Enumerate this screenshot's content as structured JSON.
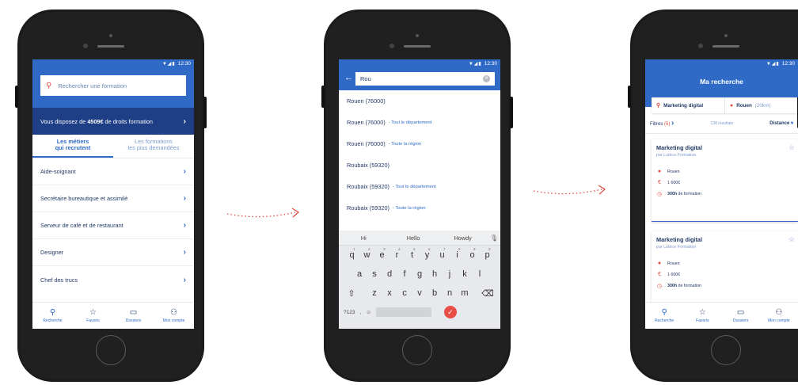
{
  "colors": {
    "primary": "#2f6bc6",
    "navy": "#1e3f86",
    "accent": "#e04b3f"
  },
  "status_time": "12:30",
  "screen1": {
    "search_placeholder": "Rechercher une formation",
    "banner_prefix": "Vous disposez de ",
    "banner_amount": "4509€",
    "banner_suffix": " de droits formation",
    "tabs": [
      {
        "line1": "Les métiers",
        "line2": "qui recrutent"
      },
      {
        "line1": "Les formations",
        "line2": "les plus demandées"
      }
    ],
    "items": [
      "Aide-soignant",
      "Secrétaire bureautique et assimilé",
      "Serveur de café et de restaurant",
      "Designer",
      "Chef des trucs"
    ]
  },
  "tabbar": [
    "Recherche",
    "Favoris",
    "Dossiers",
    "Mon compte"
  ],
  "screen2": {
    "query": "Rou",
    "suggestions": [
      {
        "main": "Rouen (76000)",
        "sub": ""
      },
      {
        "main": "Rouen (76000)",
        "sub": "- Tout le département"
      },
      {
        "main": "Rouen (76000)",
        "sub": "- Toute la région"
      },
      {
        "main": "Roubaix (59320)",
        "sub": ""
      },
      {
        "main": "Roubaix (59320)",
        "sub": "- Tout le département"
      },
      {
        "main": "Roubaix (59320)",
        "sub": "- Toute la région"
      }
    ],
    "predictions": [
      "Hi",
      "Hello",
      "Howdy"
    ],
    "keys_row1": [
      "q",
      "w",
      "e",
      "r",
      "t",
      "y",
      "u",
      "i",
      "o",
      "p"
    ],
    "keys_row1_nums": [
      "1",
      "2",
      "3",
      "4",
      "5",
      "6",
      "7",
      "8",
      "9",
      "0"
    ],
    "keys_row2": [
      "a",
      "s",
      "d",
      "f",
      "g",
      "h",
      "j",
      "k",
      "l"
    ],
    "keys_row3": [
      "z",
      "x",
      "c",
      "v",
      "b",
      "n",
      "m"
    ],
    "num_key": "?123",
    "comma_key": ","
  },
  "screen3": {
    "title": "Ma recherche",
    "query": "Marketing digital",
    "location": "Rouen",
    "radius": "(20km)",
    "filters_label": "Filtres",
    "filters_count": "(5)",
    "results": "138 résultats",
    "sort": "Distance",
    "cards": [
      {
        "title": "Marketing digital",
        "provider": "par Lutèce Formation",
        "city": "Rouen",
        "price": "1 600€",
        "hours": "300h",
        "hours_suffix": " de formation"
      },
      {
        "title": "Marketing digital",
        "provider": "par Lutèce Formation",
        "city": "Rouen",
        "price": "1 600€",
        "hours": "300h",
        "hours_suffix": " de formation"
      }
    ]
  }
}
